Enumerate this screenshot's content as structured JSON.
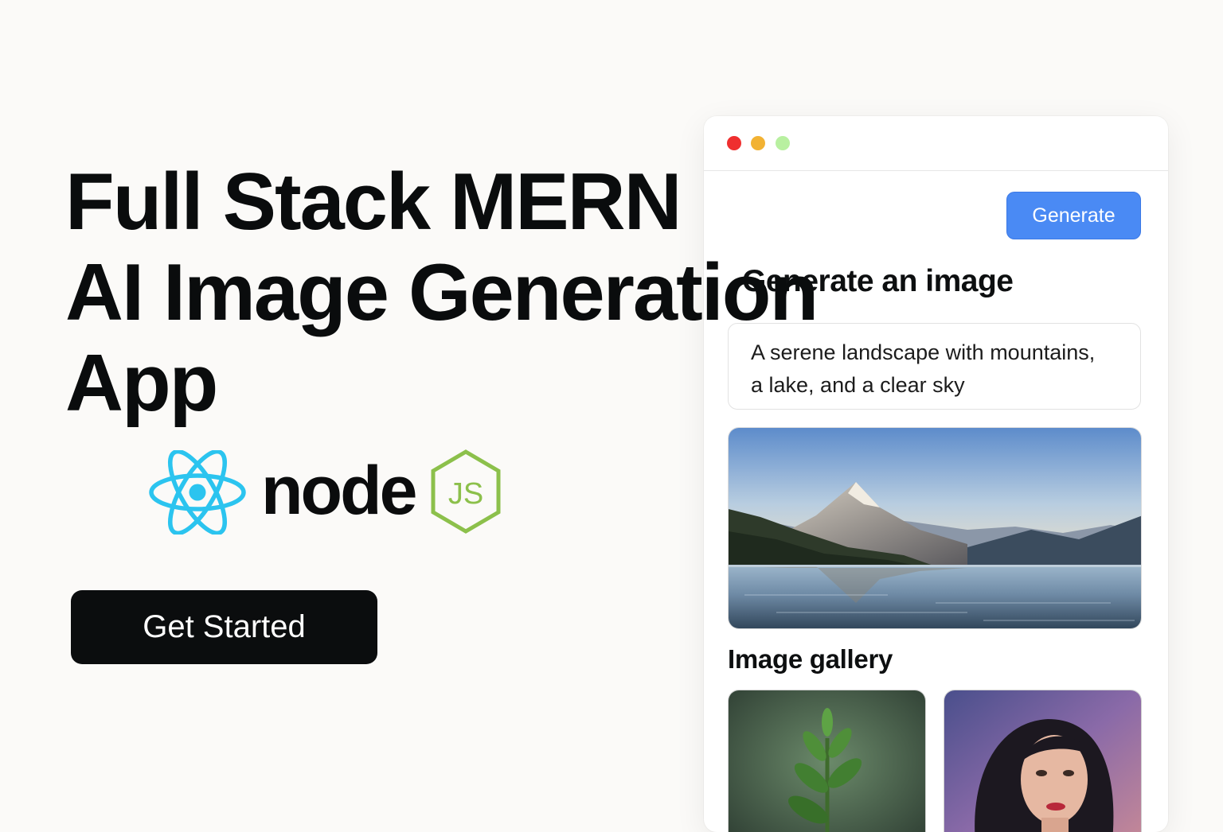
{
  "hero": {
    "title_lines": [
      "Full Stack MERN",
      "AI Image Generation",
      "App"
    ],
    "cta_label": "Get Started"
  },
  "logos": {
    "react": {
      "icon": "react-atom-icon",
      "color": "#2bc4ef"
    },
    "node": {
      "text": "node",
      "badge": "JS",
      "icon": "nodejs-hexagon-icon",
      "badge_color": "#8cc04b"
    }
  },
  "app_window": {
    "controls": [
      "close",
      "minimize",
      "maximize"
    ],
    "generate_label": "Generate",
    "heading": "Generate an image",
    "prompt_lines": [
      "A serene landscape with mountains,",
      "a lake, and a clear sky"
    ],
    "main_image": "mountain-lake-landscape",
    "gallery_title": "Image gallery",
    "gallery": [
      {
        "name": "green-plant-sprout"
      },
      {
        "name": "woman-portrait-painting"
      }
    ]
  },
  "colors": {
    "background": "#fbfaf8",
    "accent_blue": "#4a8af4",
    "cta_black": "#0b0d0e",
    "dot_red": "#ef2f2f",
    "dot_yellow": "#f2b233",
    "dot_green": "#b8f0a0"
  }
}
